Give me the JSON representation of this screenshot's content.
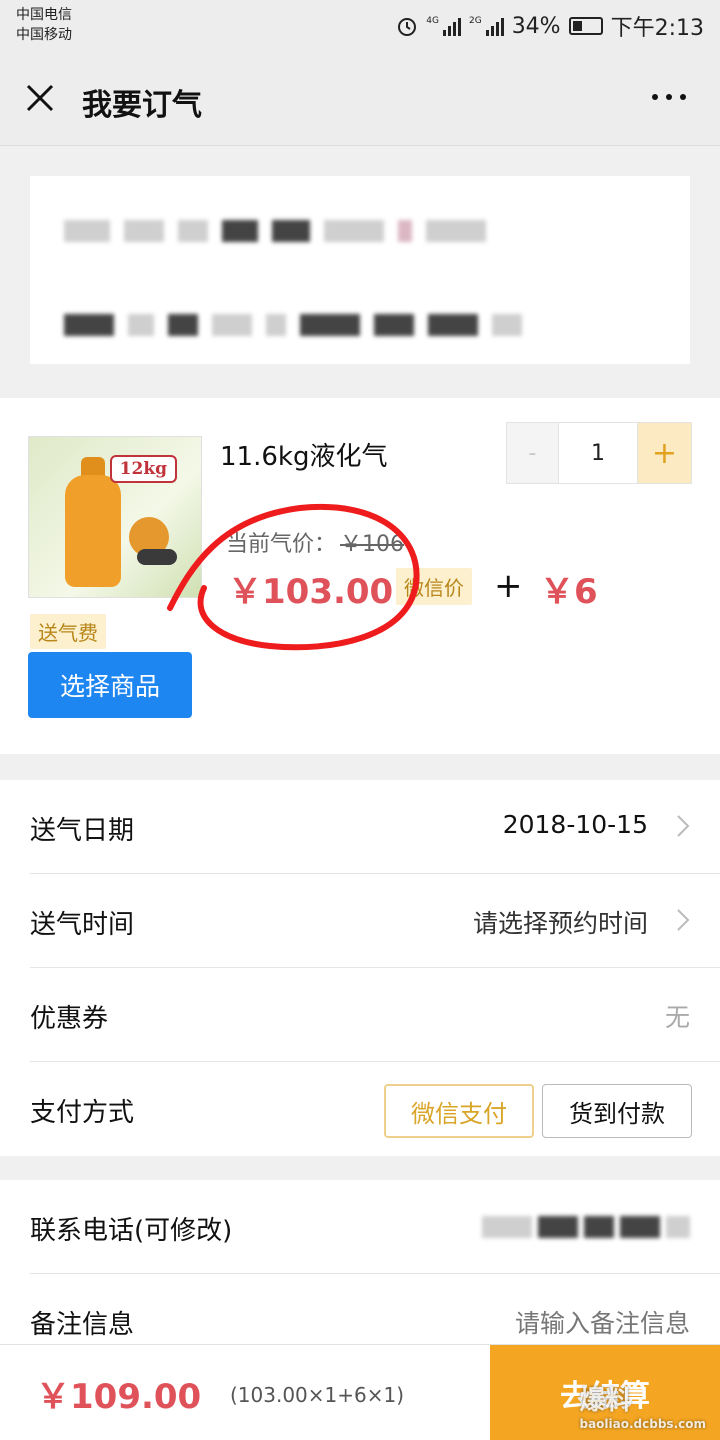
{
  "status_bar": {
    "carrier_1": "中国电信",
    "carrier_2": "中国移动",
    "net_1": "4G",
    "net_2": "2G",
    "battery": "34%",
    "time": "下午2:13"
  },
  "nav": {
    "title": "我要订气"
  },
  "product": {
    "image_tag": "12kg",
    "name": "11.6kg液化气",
    "quantity": "1",
    "minus": "-",
    "plus": "+",
    "old_price_label": "当前气价：",
    "old_price": "￥106",
    "price": "￥103.00",
    "wechat_price_label": "微信价",
    "plus_sign": "+",
    "delivery_fee": "￥6",
    "delivery_fee_label": "送气费",
    "choose_button": "选择商品"
  },
  "form": {
    "delivery_date_label": "送气日期",
    "delivery_date_value": "2018-10-15",
    "delivery_time_label": "送气时间",
    "delivery_time_placeholder": "请选择预约时间",
    "coupon_label": "优惠券",
    "coupon_value": "无",
    "payment_label": "支付方式",
    "payment_options": [
      "微信支付",
      "货到付款"
    ],
    "payment_selected": "微信支付"
  },
  "contact": {
    "phone_label": "联系电话(可修改)",
    "remark_label": "备注信息",
    "remark_placeholder": "请输入备注信息"
  },
  "footer": {
    "total": "￥109.00",
    "breakdown": "(103.00×1+6×1)",
    "checkout_button": "去结算"
  },
  "watermark": {
    "text": "爆料",
    "url": "baoliao.dcbbs.com"
  },
  "colors": {
    "accent_price": "#e0525a",
    "primary_button": "#1e86f0",
    "checkout": "#f4a623",
    "badge_bg": "#fdf0cf"
  }
}
